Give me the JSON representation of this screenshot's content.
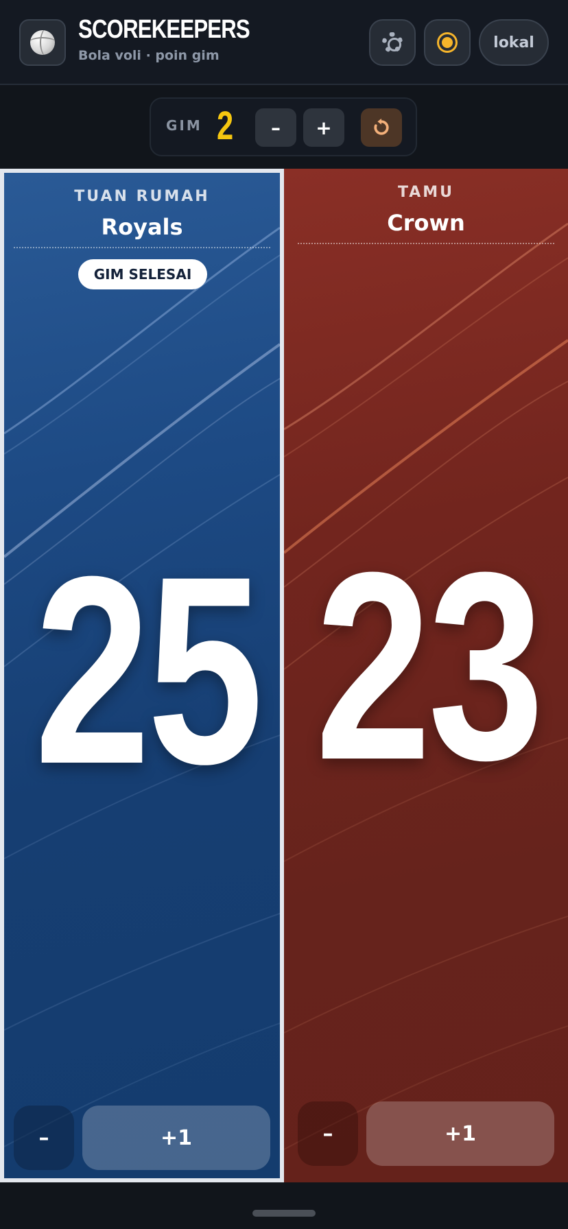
{
  "header": {
    "title": "SCOREKEEPERS",
    "subtitle": "Bola voli · poin gim",
    "logo_icon": "volleyball-icon",
    "settings_icon": "gear-icon",
    "theme_icon": "sun-icon",
    "mode_label": "lokal"
  },
  "game": {
    "label": "GIM",
    "number": "2",
    "minus_label": "–",
    "plus_label": "+",
    "reset_icon": "reset-icon"
  },
  "teams": [
    {
      "role": "TUAN RUMAH",
      "name": "Royals",
      "score": "25",
      "badge": "GIM SELESAI",
      "minus_label": "–",
      "plus_label": "+1",
      "color": "#1d4a84"
    },
    {
      "role": "TAMU",
      "name": "Crown",
      "score": "23",
      "minus_label": "–",
      "plus_label": "+1",
      "color": "#72251e"
    }
  ],
  "colors": {
    "accent_game_number": "#f6c710",
    "reset_accent": "#f3b07a",
    "background": "#11151b"
  }
}
